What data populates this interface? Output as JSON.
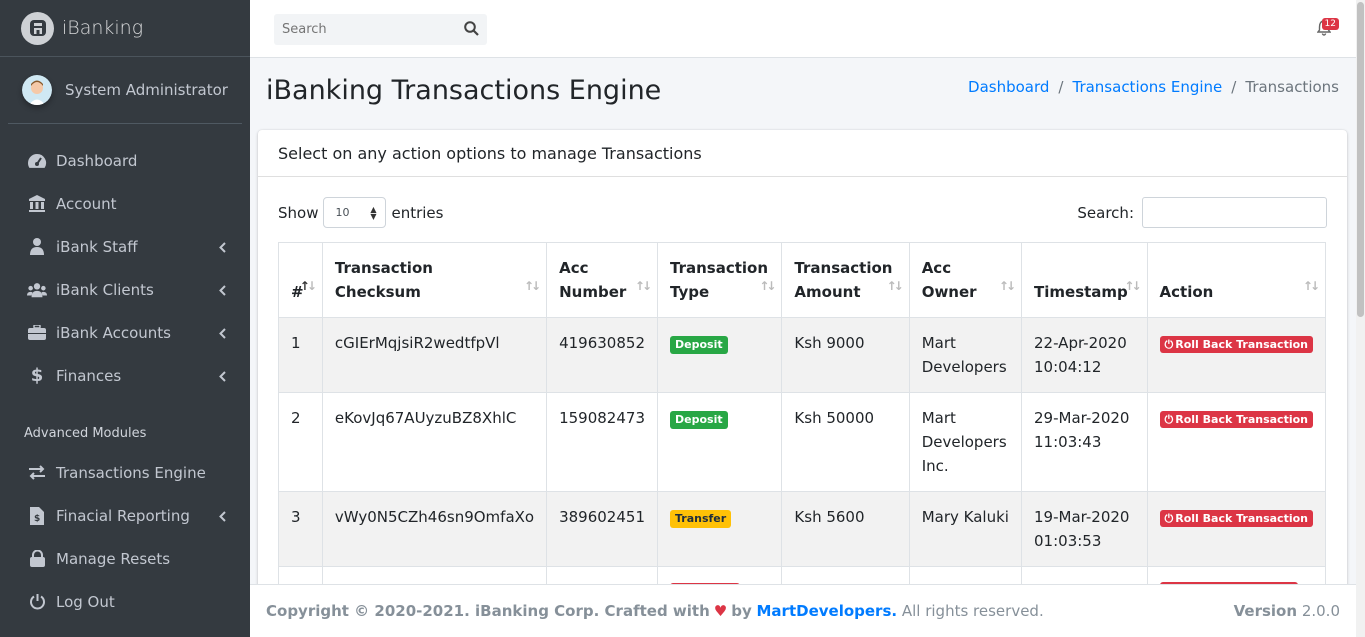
{
  "brand": {
    "name": "iBanking"
  },
  "user": {
    "name": "System Administrator"
  },
  "sidebar": {
    "items": [
      {
        "label": "Dashboard"
      },
      {
        "label": "Account"
      },
      {
        "label": "iBank Staff"
      },
      {
        "label": "iBank Clients"
      },
      {
        "label": "iBank Accounts"
      },
      {
        "label": "Finances"
      }
    ],
    "section_header": "Advanced Modules",
    "advanced_items": [
      {
        "label": "Transactions Engine"
      },
      {
        "label": "Finacial Reporting"
      },
      {
        "label": "Manage Resets"
      },
      {
        "label": "Log Out"
      }
    ]
  },
  "topbar": {
    "search_placeholder": "Search",
    "notification_count": "12"
  },
  "page": {
    "title": "iBanking Transactions Engine"
  },
  "breadcrumb": {
    "items": [
      "Dashboard",
      "Transactions Engine"
    ],
    "active": "Transactions"
  },
  "card": {
    "header": "Select on any action options to manage Transactions"
  },
  "table_controls": {
    "show_label": "Show",
    "entries_value": "10",
    "entries_label": "entries",
    "search_label": "Search:"
  },
  "table": {
    "columns": [
      "#",
      "Transaction Checksum",
      "Acc Number",
      "Transaction Type",
      "Transaction Amount",
      "Acc Owner",
      "Timestamp",
      "Action"
    ],
    "rows": [
      {
        "num": "1",
        "checksum": "cGIErMqjsiR2wedtfpVl",
        "acc": "419630852",
        "type": "Deposit",
        "amount": "Ksh 9000",
        "owner": "Mart Developers",
        "ts_date": "22-Apr-2020",
        "ts_time": "10:04:12",
        "action": "Roll Back Transaction"
      },
      {
        "num": "2",
        "checksum": "eKovJq67AUyzuBZ8XhlC",
        "acc": "159082473",
        "type": "Deposit",
        "amount": "Ksh 50000",
        "owner": "Mart Developers Inc.",
        "ts_date": "29-Mar-2020",
        "ts_time": "11:03:43",
        "action": "Roll Back Transaction"
      },
      {
        "num": "3",
        "checksum": "vWy0N5CZh46sn9OmfaXo",
        "acc": "389602451",
        "type": "Transfer",
        "amount": "Ksh 5600",
        "owner": "Mary Kaluki",
        "ts_date": "19-Mar-2020",
        "ts_time": "01:03:53",
        "action": "Roll Back Transaction"
      }
    ]
  },
  "footer": {
    "copyright": "Copyright © 2020-2021. iBanking Corp. Crafted with",
    "by": "by",
    "author": "MartDevelopers.",
    "rights": "All rights reserved.",
    "version_label": "Version",
    "version": "2.0.0"
  },
  "colors": {
    "sidebar_bg": "#343a40",
    "primary": "#007bff",
    "success": "#28a745",
    "warning": "#ffc107",
    "danger": "#dc3545"
  },
  "icons": [
    "tachometer-icon",
    "building-icon",
    "user-tie-icon",
    "users-icon",
    "briefcase-icon",
    "dollar-icon",
    "exchange-icon",
    "file-invoice-icon",
    "lock-icon",
    "power-icon",
    "search-icon",
    "bell-icon",
    "heart-icon"
  ]
}
